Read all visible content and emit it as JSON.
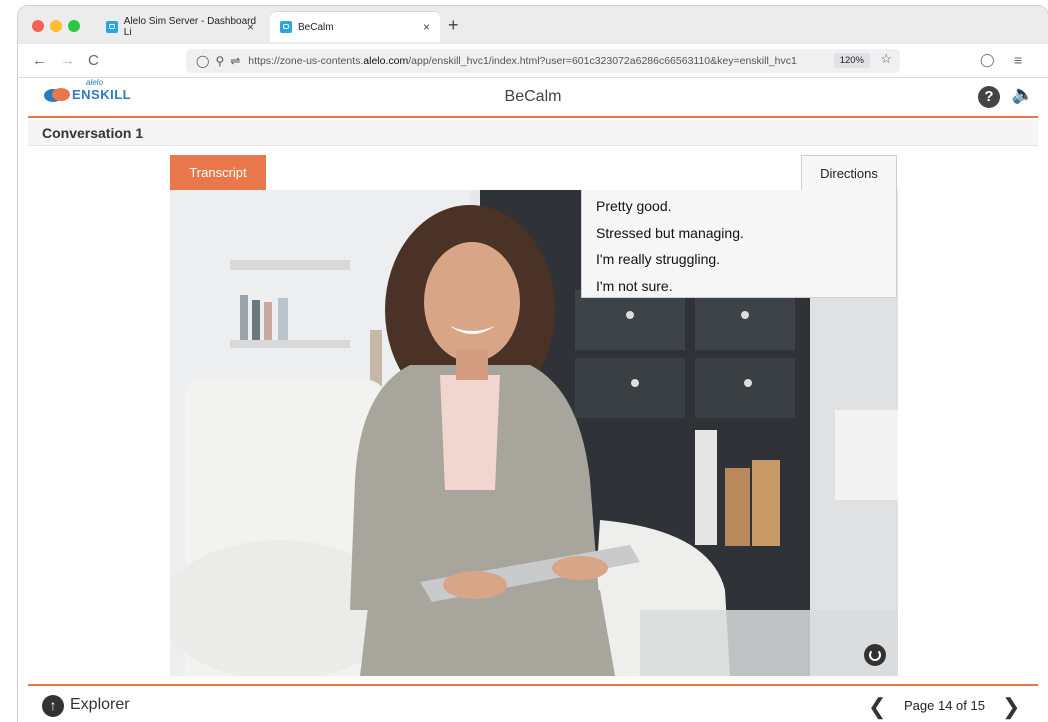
{
  "browser": {
    "tabs": [
      {
        "label": "Alelo Sim Server - Dashboard Li",
        "close": "×"
      },
      {
        "label": "BeCalm",
        "close": "×"
      }
    ],
    "new_tab": "+",
    "nav": {
      "back": "←",
      "forward": "→",
      "reload": "C"
    },
    "url_prefix": "https://zone-us-contents.",
    "url_domain": "alelo.com",
    "url_rest": "/app/enskill_hvc1/index.html?user=601c323072a6286c66563110&key=enskill_hvc1",
    "zoom": "120%",
    "pocket_icon": "pocket-icon",
    "menu_icon": "hamburger-icon"
  },
  "app": {
    "logo_small": "alelo",
    "logo_main": "ENSKILL",
    "title": "BeCalm",
    "conversation_title": "Conversation 1",
    "transcript_tab": "Transcript",
    "directions_tab": "Directions",
    "options": [
      "Pretty good.",
      "Stressed but managing.",
      "I'm really struggling.",
      "I'm not sure."
    ],
    "footer": {
      "explorer_label": "Explorer",
      "page_label": "Page 14 of 15"
    }
  },
  "colors": {
    "accent": "#e8784b",
    "logo_blue": "#2b7bbf"
  }
}
